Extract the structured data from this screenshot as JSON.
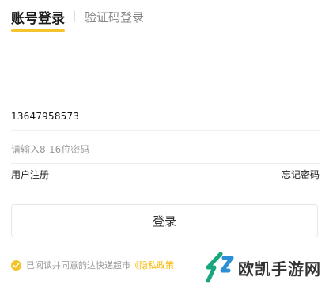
{
  "tabs": {
    "account": "账号登录",
    "code": "验证码登录"
  },
  "form": {
    "phone_value": "13647958573",
    "password_placeholder": "请输入8-16位密码",
    "register": "用户注册",
    "forgot": "忘记密码",
    "login_button": "登录"
  },
  "agreement": {
    "text": "已阅读并同意韵达快递超市",
    "policy": "《隐私政策"
  },
  "watermark": {
    "text": "欧凯手游网"
  },
  "colors": {
    "accent": "#f5c32c",
    "watermark_green": "#1aa67c"
  }
}
